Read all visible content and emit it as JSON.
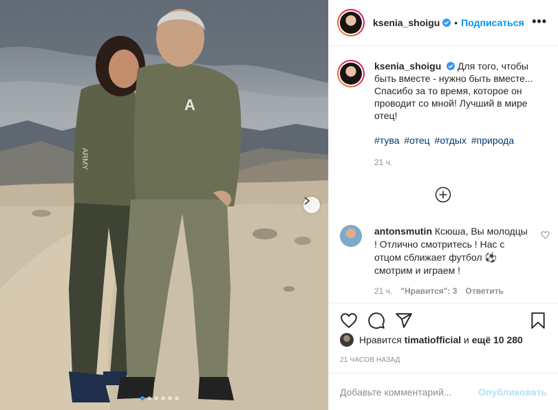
{
  "post": {
    "username": "ksenia_shoigu",
    "verified": true,
    "follow_label": "Подписаться",
    "more_label": "•••",
    "dot": "•"
  },
  "caption": {
    "username": "ksenia_shoigu",
    "text": "Для того, чтобы быть вместе - нужно быть вместе... Спасибо за то время, которое он проводит со мной! Лучший в мире отец!",
    "hashtags": [
      "#тува",
      "#отец",
      "#отдых",
      "#природа"
    ],
    "time": "21 ч."
  },
  "comment": {
    "username": "antonsmutin",
    "text": "Ксюша, Вы молодцы ! Отлично смотритесь ! Нас с отцом сближает футбол ⚽ смотрим и играем !",
    "time": "21 ч.",
    "likes": "\"Нравится\": 3",
    "reply": "Ответить"
  },
  "likes": {
    "prefix": "Нравится",
    "user": "timatiofficial",
    "middle": "и",
    "rest": "ещё 10 280"
  },
  "posted_ago": "21 ЧАСОВ НАЗАД",
  "add_comment": {
    "placeholder": "Добавьте комментарий...",
    "publish": "Опубликовать"
  },
  "icons": {
    "like": "heart-icon",
    "comment": "comment-icon",
    "share": "paper-plane-icon",
    "save": "bookmark-icon",
    "load_more": "plus-circle-icon",
    "verified": "verified-badge-icon",
    "next": "chevron-right-icon"
  },
  "carousel": {
    "count": 6,
    "active_index": 0
  },
  "colors": {
    "accent": "#0095f6",
    "hashtag": "#00376b",
    "muted": "#8e8e8e"
  }
}
